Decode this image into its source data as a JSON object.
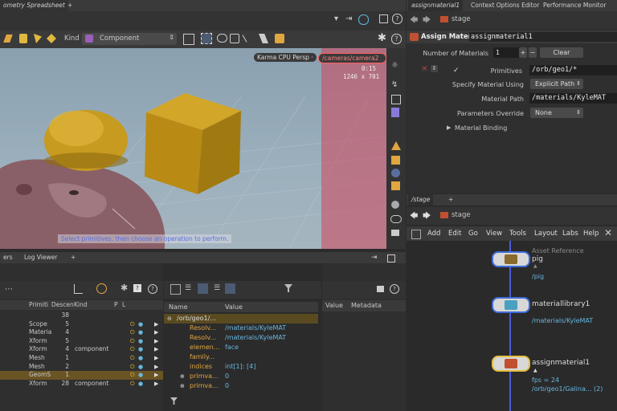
{
  "top_left_tabs": {
    "spreadsheet": "ometry Spreadsheet",
    "add": "+"
  },
  "top_right_tabs": [
    {
      "label": "assignmaterial1"
    },
    {
      "label": "Context Options Editor"
    },
    {
      "label": "Performance Monitor"
    }
  ],
  "viewport_toolbar": {
    "kind_label": "Kind",
    "kind_value": "Component"
  },
  "viewport": {
    "renderer": "Karma CPU  Persp ·",
    "camera": "/cameras/camera2 ·",
    "time": "0:15",
    "resolution": "1246 x 701",
    "hint": "Select primitives, then choose an operation to perform."
  },
  "params": {
    "path": "stage",
    "node_type": "Assign Material",
    "node_name": "assignmaterial1",
    "num_materials_label": "Number of Materials",
    "num_materials": "1",
    "plus": "+",
    "minus": "−",
    "clear": "Clear",
    "primitives_label": "Primitives",
    "primitives_value": "/orb/geo1/*",
    "specify_label": "Specify Material Using",
    "specify_value": "Explicit Path",
    "matpath_label": "Material Path",
    "matpath_value": "/materials/KyleMAT",
    "override_label": "Parameters Override",
    "override_value": "None",
    "binding_label": "Material Binding"
  },
  "bottom_left_tabs": {
    "tab1": "ers",
    "tab2": "Log Viewer",
    "add": "+"
  },
  "scene_tree": {
    "headers": {
      "prims": "Primiti",
      "desc": "Descen",
      "kind": "Kind",
      "p": "P",
      "l": "L"
    },
    "rows": [
      {
        "name": "",
        "prims": "",
        "desc": "38",
        "kind": ""
      },
      {
        "name": "Scope",
        "prims": "",
        "desc": "5",
        "kind": ""
      },
      {
        "name": "Materia",
        "prims": "",
        "desc": "4",
        "kind": ""
      },
      {
        "name": "Xform",
        "prims": "",
        "desc": "5",
        "kind": ""
      },
      {
        "name": "Xform",
        "prims": "",
        "desc": "4",
        "kind": "component"
      },
      {
        "name": "Mesh",
        "prims": "",
        "desc": "1",
        "kind": ""
      },
      {
        "name": "Mesh",
        "prims": "",
        "desc": "2",
        "kind": ""
      },
      {
        "name": "GeomS",
        "prims": "",
        "desc": "1",
        "kind": ""
      },
      {
        "name": "Xform",
        "prims": "",
        "desc": "28",
        "kind": "component"
      }
    ]
  },
  "details": {
    "headers": {
      "name": "Name",
      "value": "Value"
    },
    "rows": [
      {
        "name": "/orb/geo1/...",
        "value": "",
        "indent": 0,
        "expand": "⊖"
      },
      {
        "name": "Resolv...",
        "value": "/materials/KyleMAT",
        "indent": 1,
        "expand": ""
      },
      {
        "name": "Resolv...",
        "value": "/materials/KyleMAT",
        "indent": 1,
        "expand": ""
      },
      {
        "name": "elemen...",
        "value": "face",
        "indent": 1,
        "expand": ""
      },
      {
        "name": "family...",
        "value": "",
        "indent": 1,
        "expand": ""
      },
      {
        "name": "indices",
        "value": "int[1]: [4]",
        "indent": 1,
        "expand": ""
      },
      {
        "name": "primva...",
        "value": "0",
        "indent": 1,
        "expand": "⊕"
      },
      {
        "name": "primva...",
        "value": "0",
        "indent": 1,
        "expand": "⊕"
      }
    ],
    "tabs": {
      "value": "Value",
      "metadata": "Metadata"
    }
  },
  "network": {
    "tab": "/stage",
    "add": "+",
    "path": "stage",
    "menu": [
      "Add",
      "Edit",
      "Go",
      "View",
      "Tools",
      "Layout",
      "Labs",
      "Help"
    ],
    "context_label": "Asset Reference",
    "nodes": [
      {
        "name": "pig",
        "sub": "/pig"
      },
      {
        "name": "materiallibrary1",
        "sub": "/materials/KyleMAT"
      },
      {
        "name": "assignmaterial1",
        "sub": "fps = 24",
        "sub2": "/orb/geo1/Galina... (2)"
      }
    ]
  },
  "colors": {
    "accent": "#3e6bd6",
    "camera_red": "#d0465a",
    "orange": "#e0a640",
    "cyan": "#67b6e0"
  }
}
